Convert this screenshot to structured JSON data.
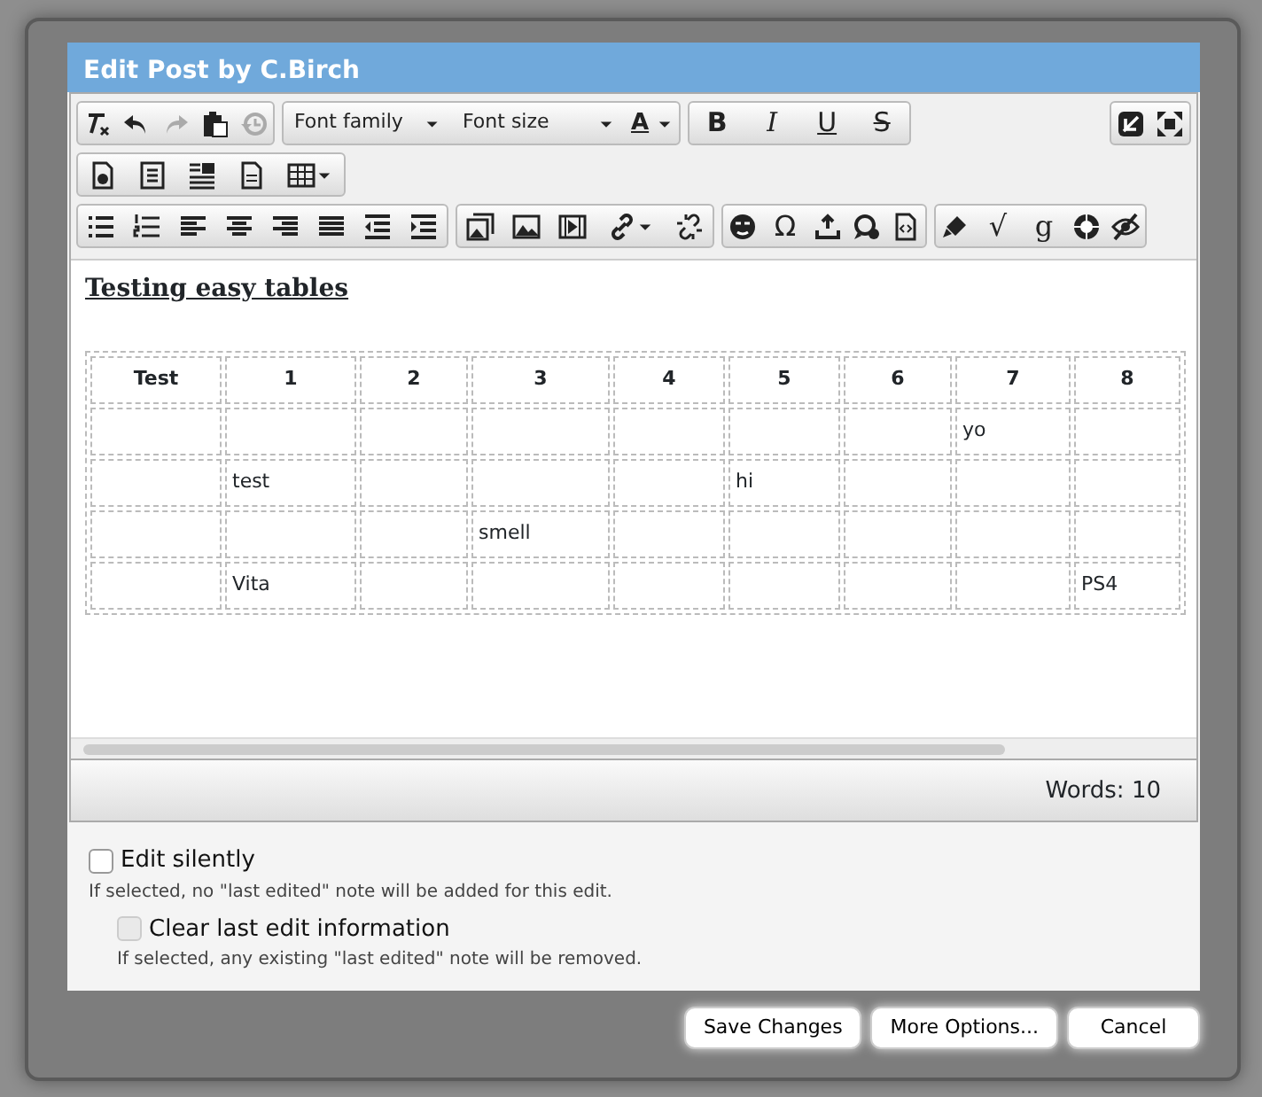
{
  "dialog": {
    "title": "Edit Post by C.Birch"
  },
  "toolbar": {
    "history": [
      {
        "disabled": false
      },
      {
        "disabled": false
      },
      {
        "disabled": true
      },
      {
        "disabled": false
      },
      {
        "disabled": true
      }
    ],
    "font_family": "Font family",
    "font_size": "Font size",
    "text_color": "A",
    "format_buttons": [
      "B",
      "I",
      "U",
      "S"
    ],
    "symbol_buttons": [
      "Ω",
      "√",
      "g"
    ]
  },
  "content": {
    "heading": "Testing easy tables",
    "table": {
      "columns": [
        "Test",
        "1",
        "2",
        "3",
        "4",
        "5",
        "6",
        "7",
        "8"
      ],
      "rows": [
        {
          "cells": [
            null,
            null,
            null,
            null,
            null,
            null,
            null,
            "yo",
            null
          ]
        },
        {
          "cells": [
            null,
            "test",
            null,
            null,
            null,
            "hi",
            null,
            null,
            null
          ]
        },
        {
          "cells": [
            null,
            null,
            null,
            "smell",
            null,
            null,
            null,
            null,
            null
          ]
        },
        {
          "cells": [
            null,
            "Vita",
            null,
            null,
            null,
            null,
            null,
            null,
            "PS4"
          ]
        }
      ]
    }
  },
  "status_bar": {
    "word_count": "Words: 10"
  },
  "options": [
    {
      "label": "Edit silently",
      "hint": "If selected, no \"last edited\" note will be added for this edit.",
      "checked": false,
      "disabled": false,
      "nested": false
    },
    {
      "label": "Clear last edit information",
      "hint": "If selected, any existing \"last edited\" note will be removed.",
      "checked": false,
      "disabled": true,
      "nested": true
    }
  ],
  "buttons": [
    "Save Changes",
    "More Options...",
    "Cancel"
  ]
}
